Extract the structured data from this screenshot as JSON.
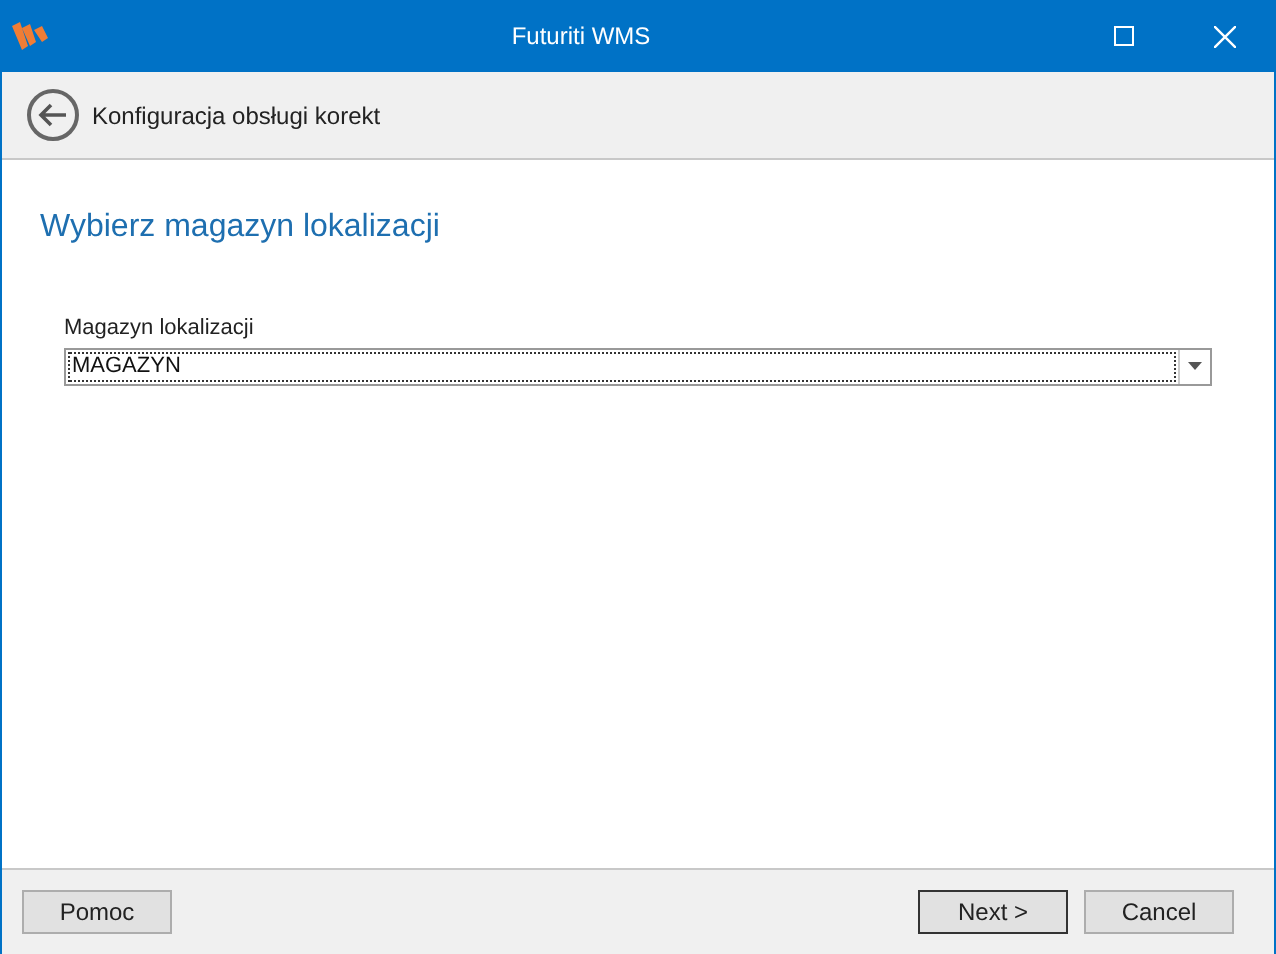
{
  "window": {
    "title": "Futuriti WMS"
  },
  "header": {
    "title": "Konfiguracja obsługi korekt"
  },
  "page": {
    "heading": "Wybierz magazyn lokalizacji"
  },
  "field": {
    "label": "Magazyn lokalizacji",
    "value": "MAGAZYN"
  },
  "footer": {
    "left_buttons": [
      {
        "label": "Pomoc",
        "default": false
      }
    ],
    "right_buttons": [
      {
        "label": "Next >",
        "default": true
      },
      {
        "label": "Cancel",
        "default": false
      }
    ]
  }
}
